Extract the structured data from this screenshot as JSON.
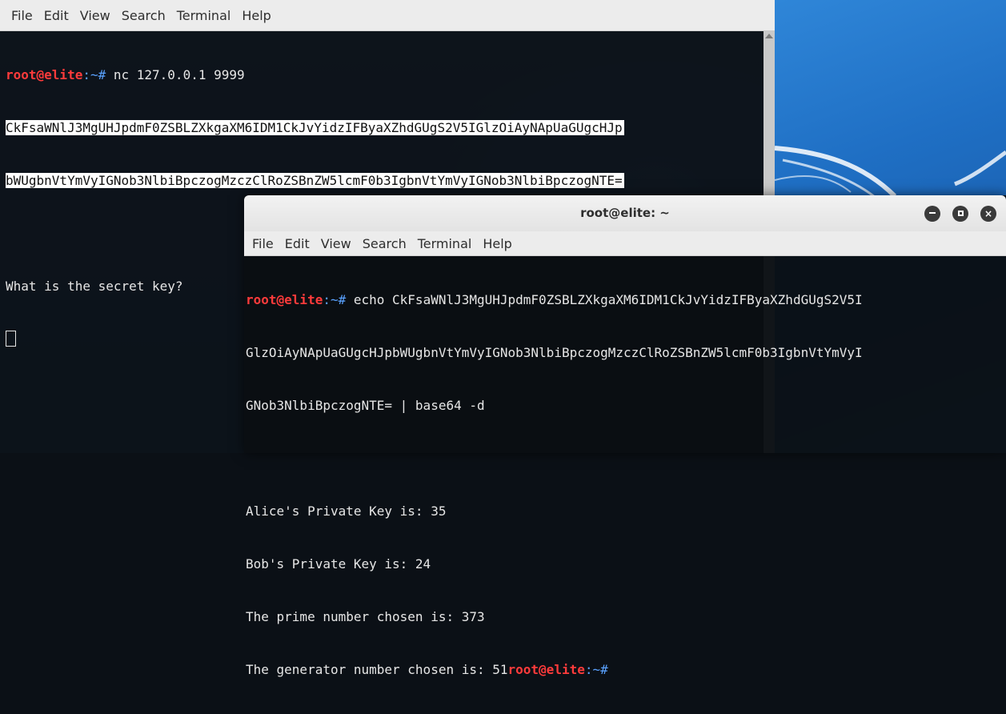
{
  "terminal1": {
    "menu": [
      "File",
      "Edit",
      "View",
      "Search",
      "Terminal",
      "Help"
    ],
    "prompt_user": "root@elite",
    "prompt_suffix": ":~#",
    "command": " nc 127.0.0.1 9999",
    "encoded_line1": "CkFsaWNlJ3MgUHJpdmF0ZSBLZXkgaXM6IDM1CkJvYidzIFByaXZhdGUgS2V5IGlzOiAyNApUaGUgcHJp",
    "encoded_line2": "bWUgbnVtYmVyIGNob3NlbiBpczogMzczClRoZSBnZW5lcmF0b3IgbnVtYmVyIGNob3NlbiBpczogNTE=",
    "question": "What is the secret key?"
  },
  "terminal2": {
    "title": "root@elite: ~",
    "menu": [
      "File",
      "Edit",
      "View",
      "Search",
      "Terminal",
      "Help"
    ],
    "prompt_user": "root@elite",
    "prompt_suffix": ":~#",
    "cmd_line1": " echo CkFsaWNlJ3MgUHJpdmF0ZSBLZXkgaXM6IDM1CkJvYidzIFByaXZhdGUgS2V5I",
    "cmd_line2": "GlzOiAyNApUaGUgcHJpbWUgbnVtYmVyIGNob3NlbiBpczogMzczClRoZSBnZW5lcmF0b3IgbnVtYmVyI",
    "cmd_line3": "GNob3NlbiBpczogNTE= | base64 -d",
    "out1": "Alice's Private Key is: 35",
    "out2": "Bob's Private Key is: 24",
    "out3": "The prime number chosen is: 373",
    "out4": "The generator number chosen is: 51",
    "buttons": {
      "minimize": "minimize",
      "maximize": "maximize",
      "close": "close"
    }
  },
  "colors": {
    "prompt": "#ff3b3b",
    "path": "#5aa2ff",
    "menubar": "#ececec",
    "desktop_accent": "#2f86d8"
  }
}
